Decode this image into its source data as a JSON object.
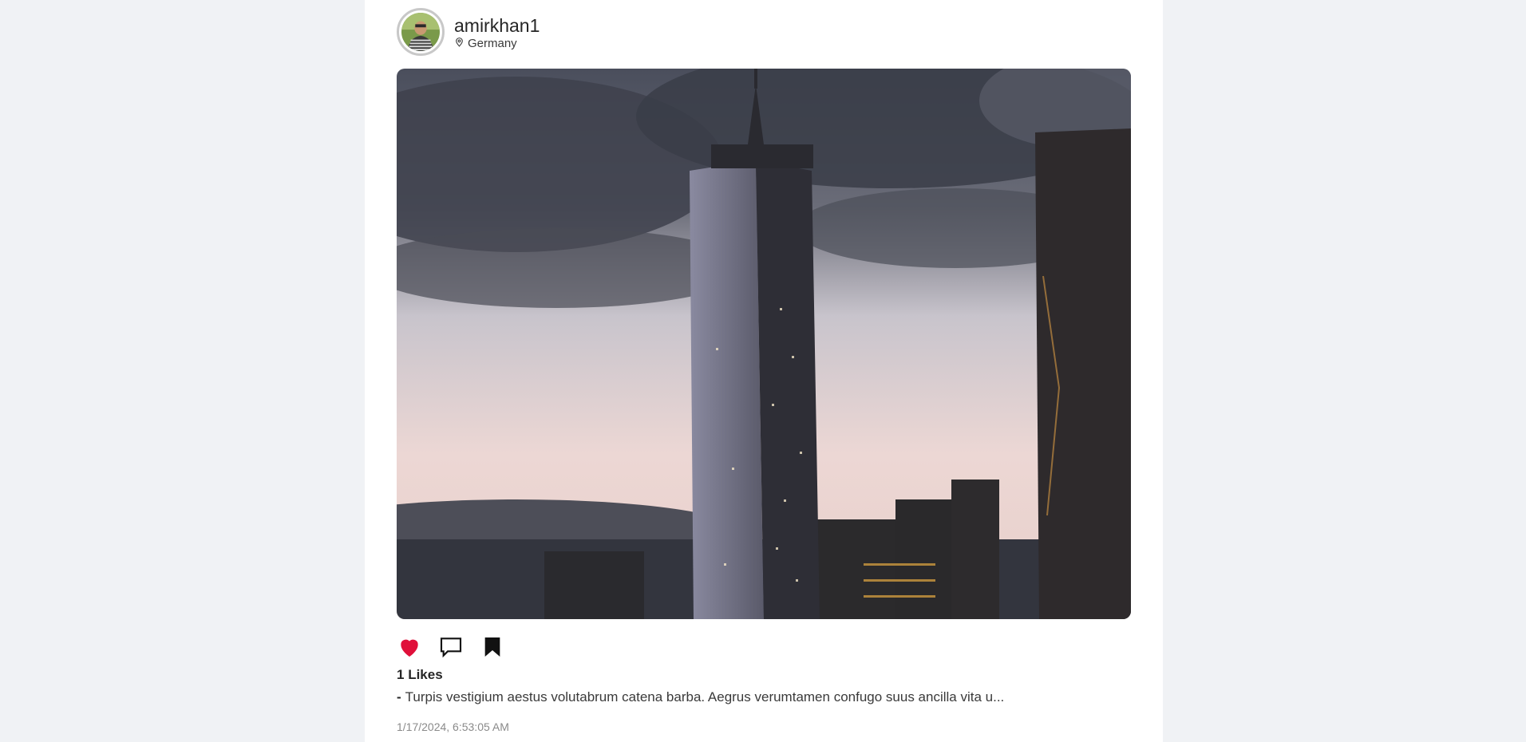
{
  "post": {
    "username": "amirkhan1",
    "location": "Germany",
    "likes_count": "1",
    "likes_suffix": "Likes",
    "caption_prefix": "-",
    "caption": "Turpis vestigium aestus volutabrum catena barba. Aegrus verumtamen confugo suus ancilla vita u...",
    "timestamp": "1/17/2024, 6:53:05 AM",
    "liked": true
  },
  "icons": {
    "location": "map-pin-icon",
    "like": "heart-icon",
    "comment": "speech-bubble-icon",
    "save": "bookmark-icon"
  },
  "colors": {
    "page_bg": "#f0f2f5",
    "card_bg": "#ffffff",
    "heart": "#e0103a",
    "text": "#262626",
    "muted": "#8a8a8a"
  }
}
